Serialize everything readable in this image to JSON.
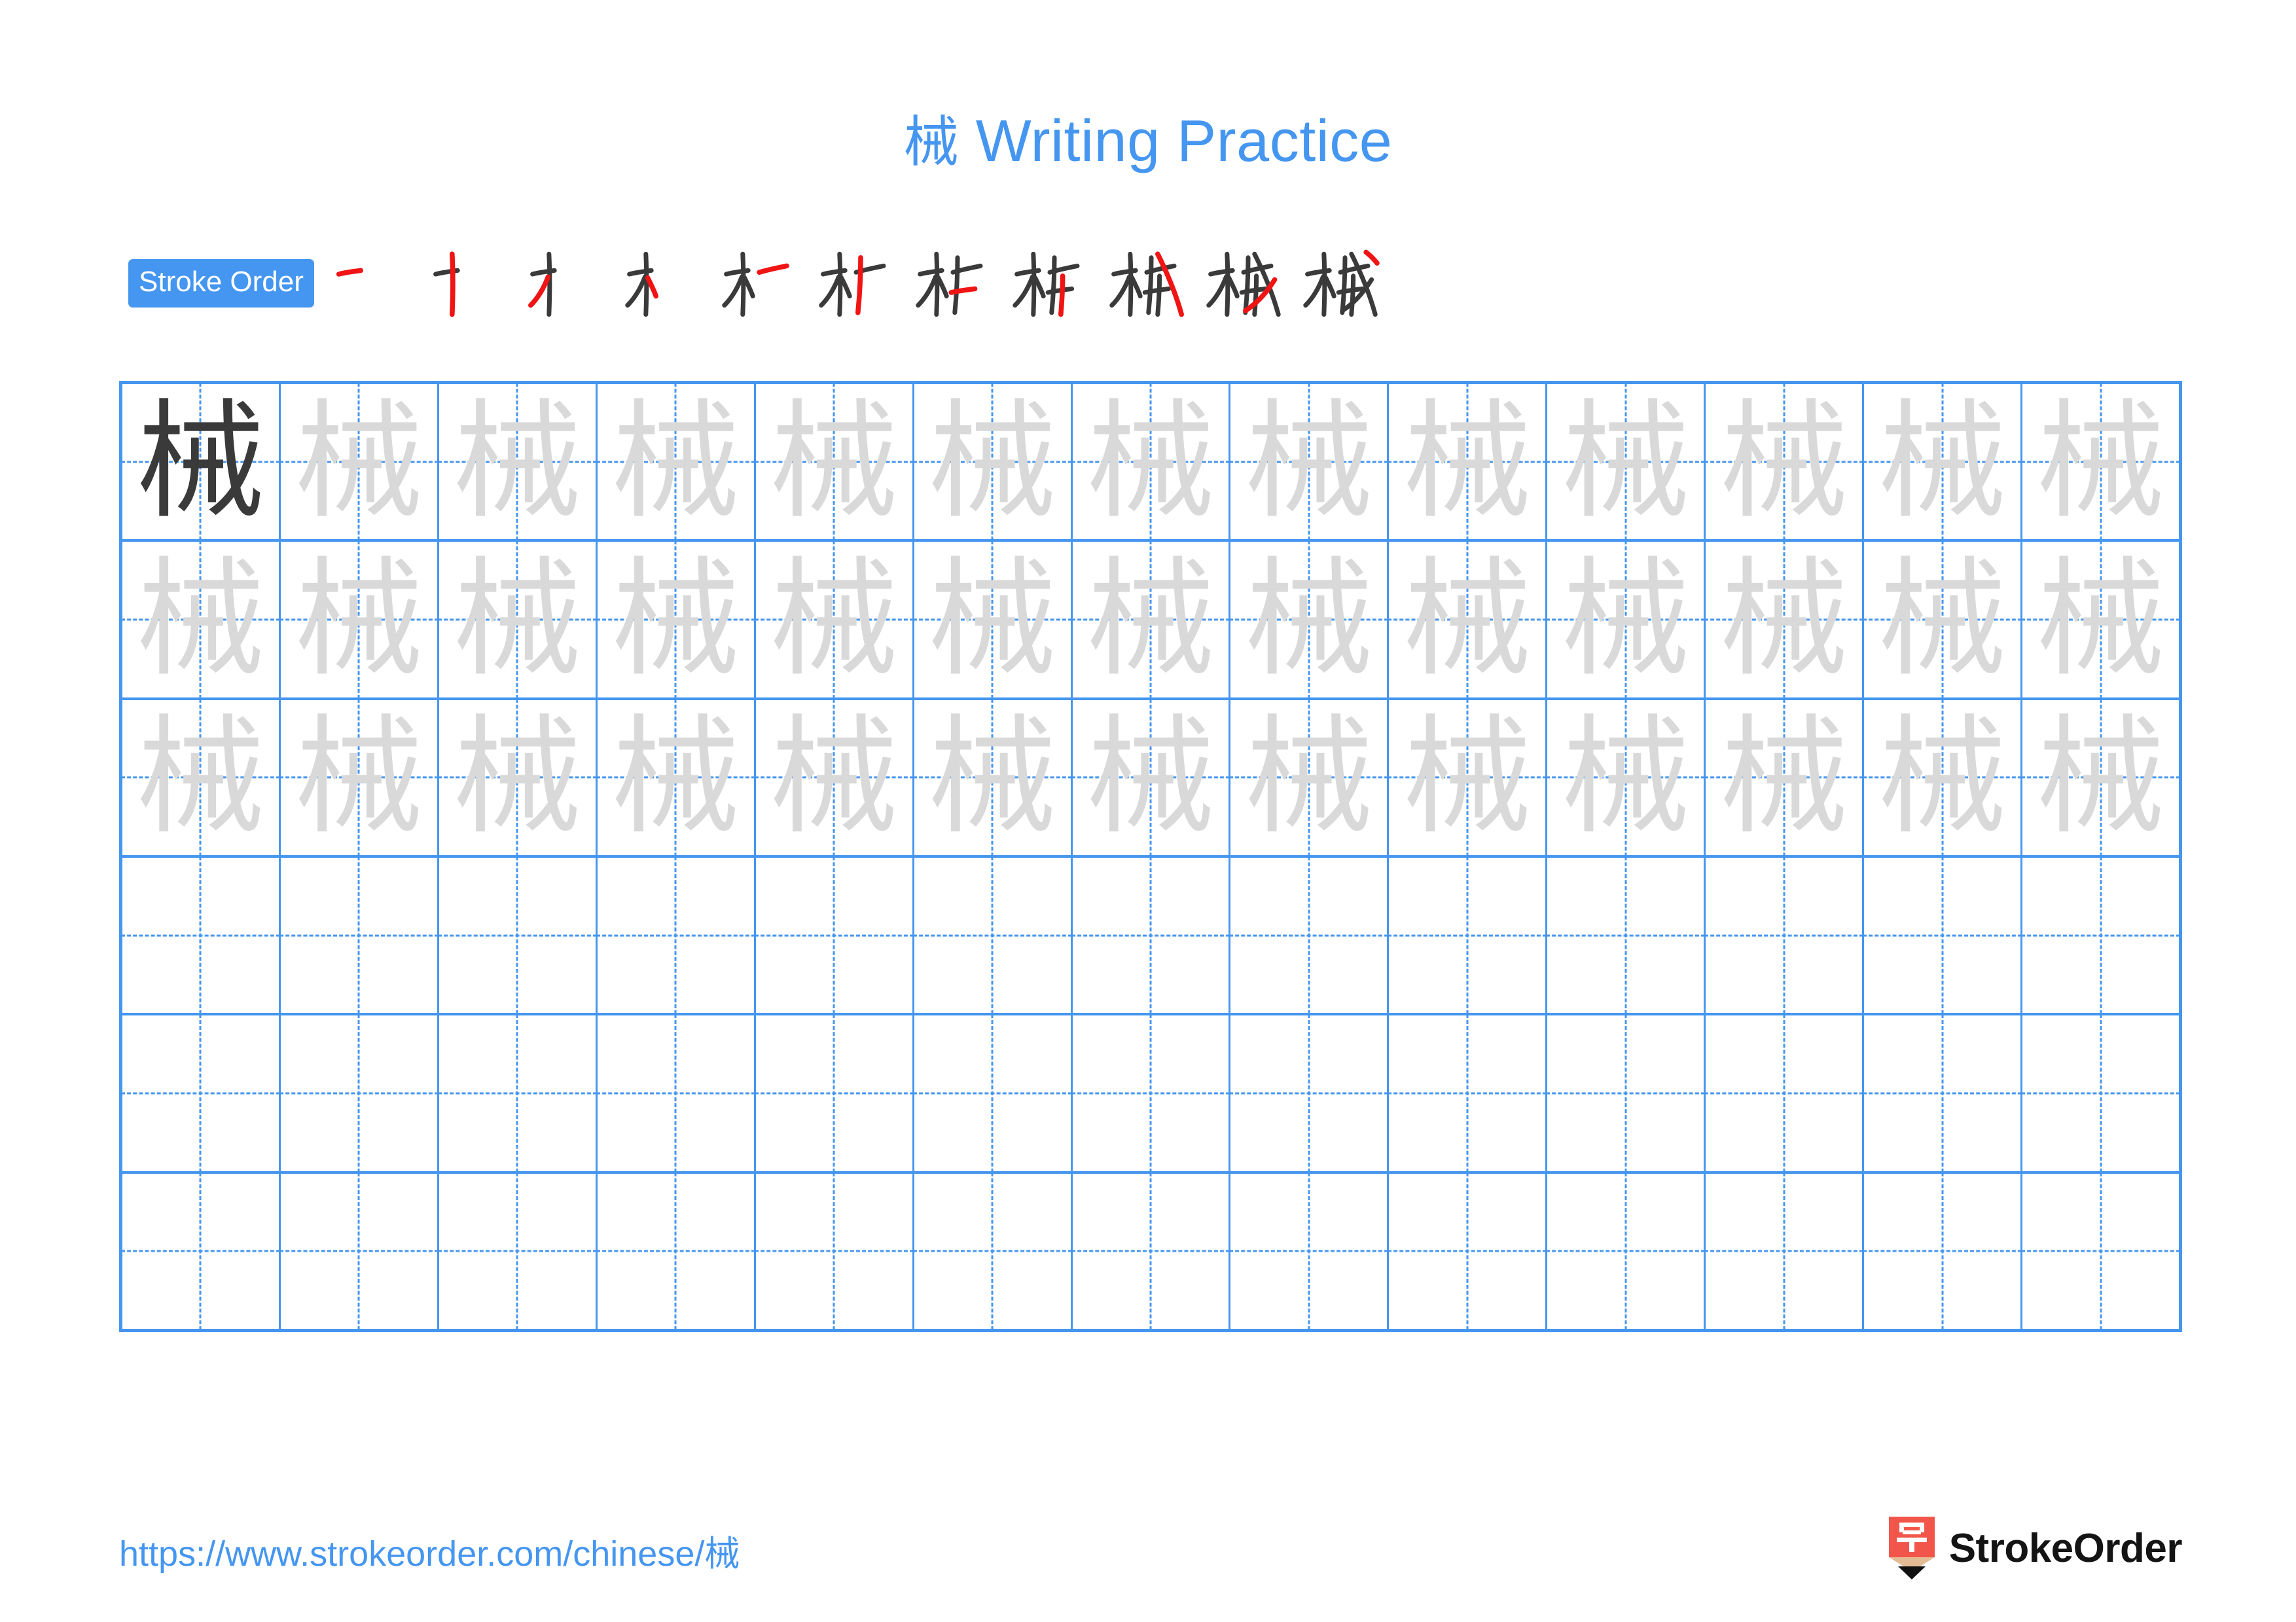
{
  "character": "械",
  "title": {
    "hanzi": "械",
    "text": " Writing Practice",
    "full": "械 Writing Practice",
    "color": "#4596f0"
  },
  "stroke_order": {
    "badge_label": "Stroke Order",
    "badge_bg": "#4596f0",
    "badge_text_color": "#ffffff",
    "total_strokes": 11,
    "new_stroke_color": "#f01414",
    "existing_stroke_color": "#3a3a3a",
    "steps": [
      {
        "index": 1,
        "strokes_shown": 1,
        "partial": "一"
      },
      {
        "index": 2,
        "strokes_shown": 2,
        "partial": "十"
      },
      {
        "index": 3,
        "strokes_shown": 3,
        "partial": "丿十"
      },
      {
        "index": 4,
        "strokes_shown": 4,
        "partial": "木"
      },
      {
        "index": 5,
        "strokes_shown": 5,
        "partial": "木一"
      },
      {
        "index": 6,
        "strokes_shown": 6,
        "partial": "术"
      },
      {
        "index": 7,
        "strokes_shown": 7,
        "partial": "杧"
      },
      {
        "index": 8,
        "strokes_shown": 8,
        "partial": "杮"
      },
      {
        "index": 9,
        "strokes_shown": 9,
        "partial": "械"
      },
      {
        "index": 10,
        "strokes_shown": 10,
        "partial": "械"
      },
      {
        "index": 11,
        "strokes_shown": 11,
        "partial": "械"
      }
    ]
  },
  "practice_grid": {
    "columns": 13,
    "rows": 6,
    "grid_line_color": "#4596f0",
    "solid_char_color": "#3a3a3a",
    "faded_char_color": "#d9d9d9",
    "cells": [
      [
        "solid",
        "faded",
        "faded",
        "faded",
        "faded",
        "faded",
        "faded",
        "faded",
        "faded",
        "faded",
        "faded",
        "faded",
        "faded"
      ],
      [
        "faded",
        "faded",
        "faded",
        "faded",
        "faded",
        "faded",
        "faded",
        "faded",
        "faded",
        "faded",
        "faded",
        "faded",
        "faded"
      ],
      [
        "faded",
        "faded",
        "faded",
        "faded",
        "faded",
        "faded",
        "faded",
        "faded",
        "faded",
        "faded",
        "faded",
        "faded",
        "faded"
      ],
      [
        "empty",
        "empty",
        "empty",
        "empty",
        "empty",
        "empty",
        "empty",
        "empty",
        "empty",
        "empty",
        "empty",
        "empty",
        "empty"
      ],
      [
        "empty",
        "empty",
        "empty",
        "empty",
        "empty",
        "empty",
        "empty",
        "empty",
        "empty",
        "empty",
        "empty",
        "empty",
        "empty"
      ],
      [
        "empty",
        "empty",
        "empty",
        "empty",
        "empty",
        "empty",
        "empty",
        "empty",
        "empty",
        "empty",
        "empty",
        "empty",
        "empty"
      ]
    ]
  },
  "footer": {
    "url": "https://www.strokeorder.com/chinese/械",
    "url_color": "#4596f0",
    "brand_name": "StrokeOrder",
    "brand_glyph": "字",
    "brand_body_color": "#f2564b",
    "brand_tip_color": "#e3bc93",
    "brand_point_color": "#111111"
  }
}
